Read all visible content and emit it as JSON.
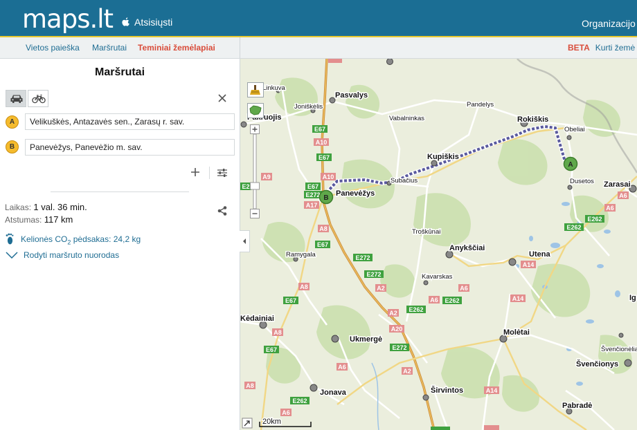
{
  "header": {
    "logo": "maps.lt",
    "download_label": "Atsisiųsti",
    "org_label": "Organizacijo"
  },
  "nav": {
    "items": [
      {
        "label": "Vietos paieška"
      },
      {
        "label": "Maršrutai"
      },
      {
        "label": "Teminiai žemėlapiai",
        "active": true
      }
    ],
    "beta": "BETA",
    "create": "Kurti žemė"
  },
  "panel": {
    "title": "Maršrutai",
    "travel_modes": [
      "car",
      "bike"
    ],
    "waypoints": [
      {
        "marker": "A",
        "value": "Velikuškės, Antazavės sen., Zarasų r. sav."
      },
      {
        "marker": "B",
        "value": "Panevėžys, Panevėžio m. sav."
      }
    ],
    "duration_label": "Laikas:",
    "duration_value": "1 val. 36 min.",
    "distance_label": "Atstumas:",
    "distance_value": "117 km",
    "co2_prefix": "Kelionės CO",
    "co2_sub": "2",
    "co2_suffix": " pėdsakas: 24,2 kg",
    "directions_link": "Rodyti maršruto nuorodas"
  },
  "map": {
    "scale_label": "20km",
    "route_color": "#5a5a9e",
    "route_markers": [
      "A",
      "B"
    ],
    "cities": [
      {
        "name": "Panevėžys"
      },
      {
        "name": "Rokiškis"
      },
      {
        "name": "Kupiškis"
      },
      {
        "name": "Anykščiai"
      },
      {
        "name": "Utena"
      },
      {
        "name": "Ukmergė"
      },
      {
        "name": "Molėtai"
      },
      {
        "name": "Jonava"
      },
      {
        "name": "Širvintos"
      },
      {
        "name": "Pabradė"
      },
      {
        "name": "Švenčionys"
      },
      {
        "name": "Zarasai"
      },
      {
        "name": "Pasvalys"
      },
      {
        "name": "Kėdainiai"
      }
    ],
    "towns": [
      "Linkuva",
      "Joniškėlis",
      "Vabalninkas",
      "Pandelys",
      "Obeliai",
      "Dusetos",
      "Subačius",
      "Troškūnai",
      "Ramygala",
      "Kavarskas",
      "Švenčionėliai",
      "Pakruojis",
      "Ig"
    ],
    "road_labels": [
      "A10",
      "E67",
      "A9",
      "A17",
      "E272",
      "E262",
      "A8",
      "A2",
      "A6",
      "A14",
      "A20"
    ]
  }
}
